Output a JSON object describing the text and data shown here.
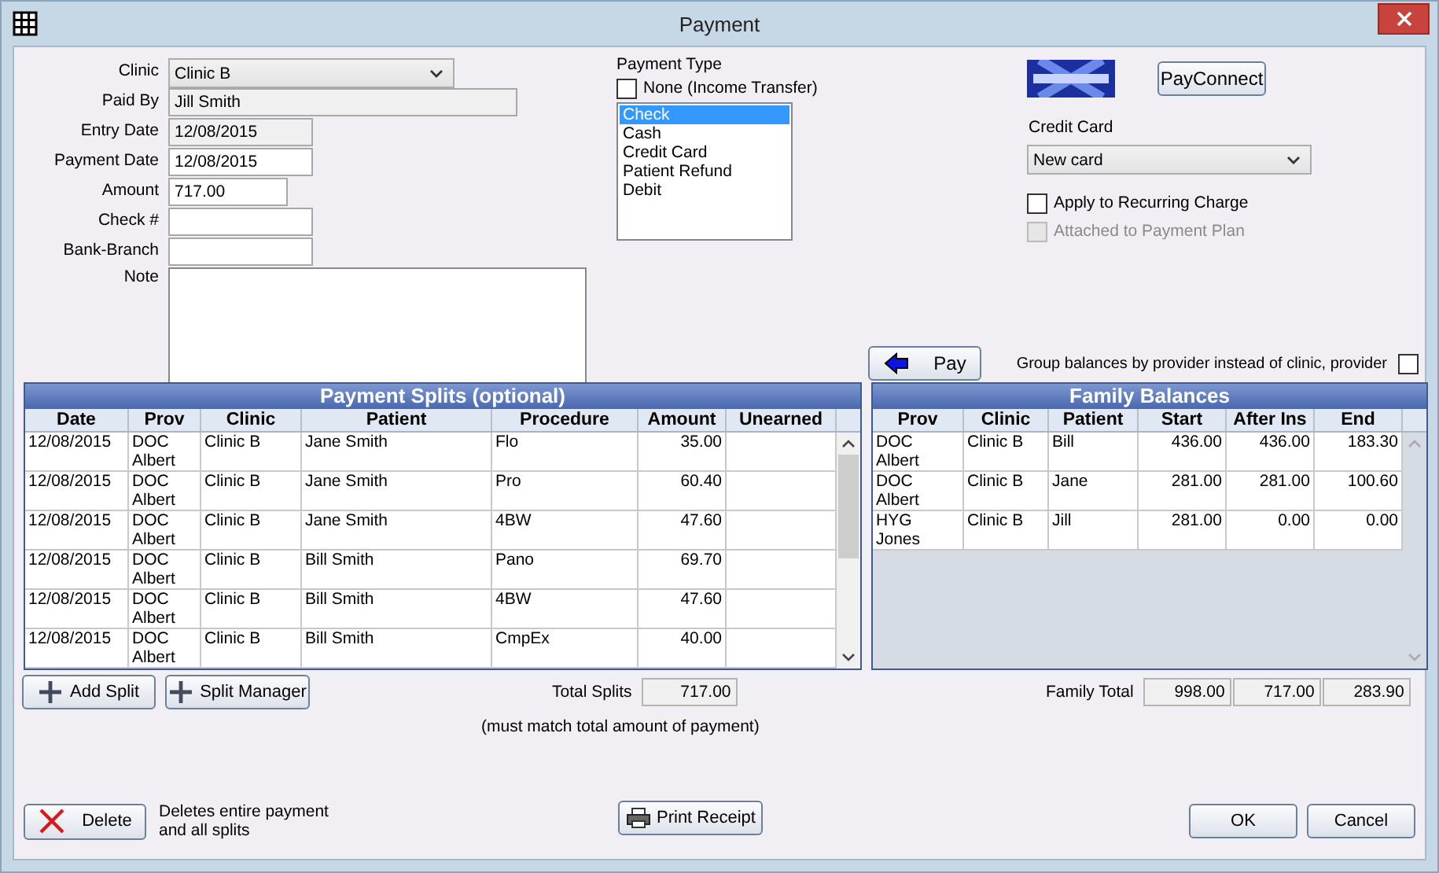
{
  "window": {
    "title": "Payment"
  },
  "form": [
    {
      "label": "Clinic",
      "kind": "dropdown",
      "value": "Clinic B"
    },
    {
      "label": "Paid By",
      "kind": "readonly",
      "value": "Jill Smith"
    },
    {
      "label": "Entry Date",
      "kind": "readonly",
      "value": "12/08/2015"
    },
    {
      "label": "Payment Date",
      "kind": "text",
      "value": "12/08/2015"
    },
    {
      "label": "Amount",
      "kind": "text",
      "value": "717.00"
    },
    {
      "label": "Check #",
      "kind": "text"
    },
    {
      "label": "Bank-Branch",
      "kind": "text"
    },
    {
      "label": "Note",
      "kind": "textarea"
    }
  ],
  "payment_type": {
    "label": "Payment Type",
    "none_checkbox": {
      "label": "None (Income Transfer)",
      "checked": false
    },
    "options": [
      {
        "label": "Check",
        "selected": true
      },
      {
        "label": "Cash",
        "selected": false
      },
      {
        "label": "Credit Card",
        "selected": false
      },
      {
        "label": "Patient Refund",
        "selected": false
      },
      {
        "label": "Debit",
        "selected": false
      }
    ]
  },
  "payconnect_button": "PayConnect",
  "credit_card": {
    "label": "Credit Card",
    "value": "New card"
  },
  "checkboxes": [
    {
      "label": "Apply to Recurring Charge",
      "checked": false,
      "disabled": false
    },
    {
      "label": "Attached to Payment Plan",
      "checked": false,
      "disabled": true
    }
  ],
  "pay_button": "Pay",
  "group_balances": {
    "label": "Group balances by provider instead of clinic, provider",
    "checked": false
  },
  "splits": {
    "title": "Payment Splits (optional)",
    "columns": [
      "Date",
      "Prov",
      "Clinic",
      "Patient",
      "Procedure",
      "Amount",
      "Unearned"
    ],
    "rows": [
      [
        "12/08/2015",
        "DOC Albert",
        "Clinic B",
        "Jane Smith",
        "Flo",
        "35.00",
        ""
      ],
      [
        "12/08/2015",
        "DOC Albert",
        "Clinic B",
        "Jane Smith",
        "Pro",
        "60.40",
        ""
      ],
      [
        "12/08/2015",
        "DOC Albert",
        "Clinic B",
        "Jane Smith",
        "4BW",
        "47.60",
        ""
      ],
      [
        "12/08/2015",
        "DOC Albert",
        "Clinic B",
        "Bill Smith",
        "Pano",
        "69.70",
        ""
      ],
      [
        "12/08/2015",
        "DOC Albert",
        "Clinic B",
        "Bill Smith",
        "4BW",
        "47.60",
        ""
      ],
      [
        "12/08/2015",
        "DOC Albert",
        "Clinic B",
        "Bill Smith",
        "CmpEx",
        "40.00",
        ""
      ]
    ],
    "add_button": "Add Split",
    "manager_button": "Split Manager",
    "total_label": "Total Splits",
    "total": "717.00",
    "note": "(must match total amount of payment)"
  },
  "family": {
    "title": "Family Balances",
    "columns": [
      "Prov",
      "Clinic",
      "Patient",
      "Start",
      "After Ins",
      "End"
    ],
    "rows": [
      [
        "DOC Albert",
        "Clinic B",
        "Bill",
        "436.00",
        "436.00",
        "183.30"
      ],
      [
        "DOC Albert",
        "Clinic B",
        "Jane",
        "281.00",
        "281.00",
        "100.60"
      ],
      [
        "HYG Jones",
        "Clinic B",
        "Jill",
        "281.00",
        "0.00",
        "0.00"
      ]
    ],
    "total_label": "Family Total",
    "totals": [
      "998.00",
      "717.00",
      "283.90"
    ]
  },
  "delete_button": "Delete",
  "delete_note": "Deletes entire payment and all splits",
  "print_button": "Print Receipt",
  "ok_button": "OK",
  "cancel_button": "Cancel"
}
